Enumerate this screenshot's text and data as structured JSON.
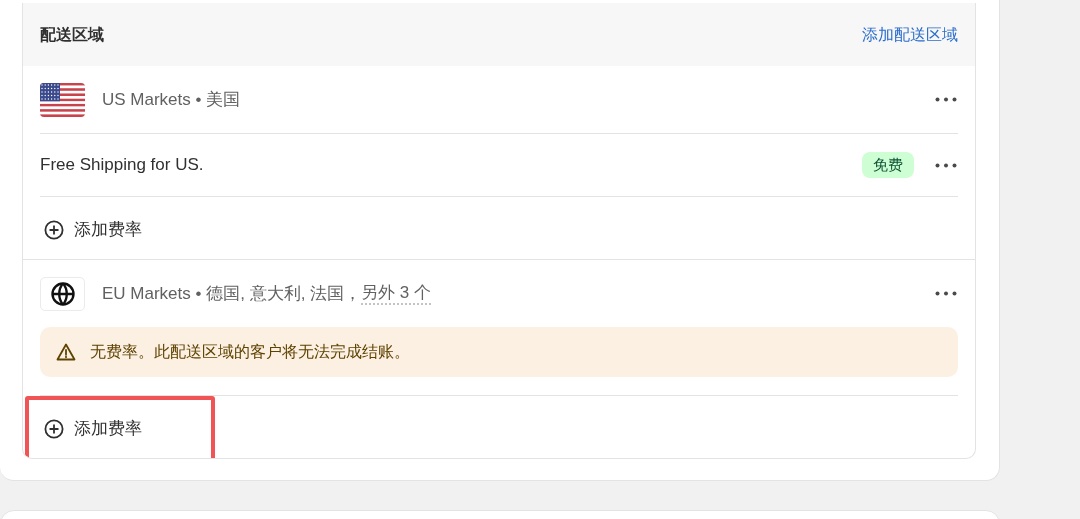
{
  "section": {
    "title": "配送区域",
    "action": "添加配送区域"
  },
  "zones": [
    {
      "kind": "flag",
      "label": "US Markets • 美国",
      "rates": [
        {
          "name": "Free Shipping for US.",
          "badge": "免费"
        }
      ],
      "add_rate": {
        "label": "添加费率",
        "highlighted": false
      }
    },
    {
      "kind": "globe",
      "label": "EU Markets • 德国, 意大利, 法国，",
      "more": "另外 3 个",
      "warning": "无费率。此配送区域的客户将无法完成结账。",
      "add_rate": {
        "label": "添加费率",
        "highlighted": true
      }
    }
  ]
}
